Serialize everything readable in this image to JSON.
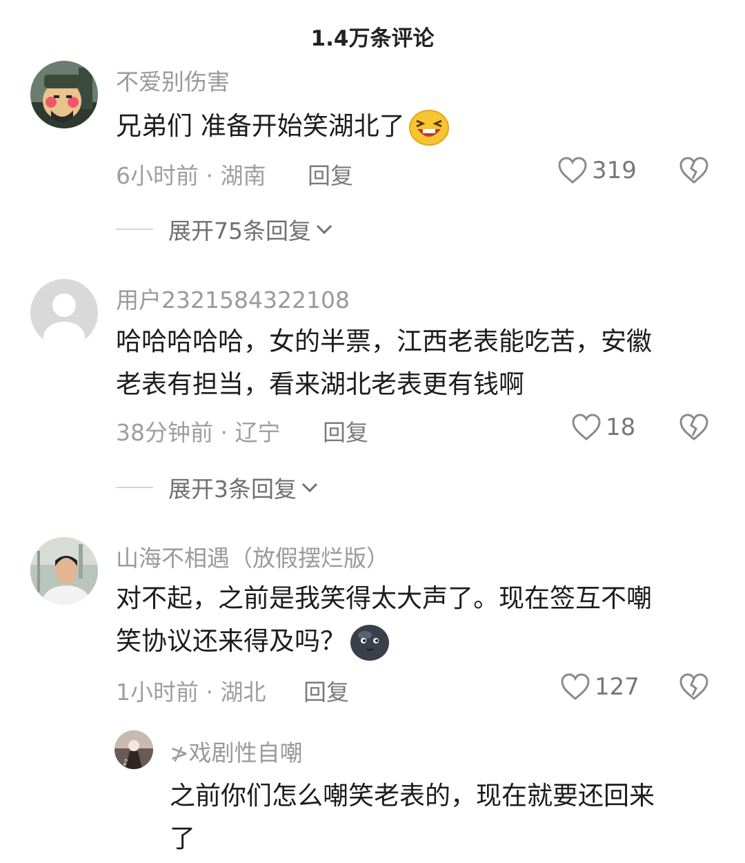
{
  "header": {
    "title": "1.4万条评论"
  },
  "comments": [
    {
      "username": "不爱别伤害",
      "text": "兄弟们 准备开始笑湖北了",
      "emoji": "laughing-emoji",
      "time": "6小时前",
      "location": "湖南",
      "reply_label": "回复",
      "likes": "319",
      "expand_label": "展开75条回复"
    },
    {
      "username": "用户2321584322108",
      "text_lines": [
        "哈哈哈哈哈，女的半票，江西老表能吃苦，安徽",
        "老表有担当，看来湖北老表更有钱啊"
      ],
      "time": "38分钟前",
      "location": "辽宁",
      "reply_label": "回复",
      "likes": "18",
      "expand_label": "展开3条回复"
    },
    {
      "username": "山海不相遇（放假摆烂版）",
      "text_lines": [
        "对不起，之前是我笑得太大声了。现在签互不嘲",
        "笑协议还来得及吗？"
      ],
      "emoji": "dark-moon-face-emoji",
      "time": "1小时前",
      "location": "湖北",
      "reply_label": "回复",
      "likes": "127"
    }
  ],
  "reply": {
    "username": "≯戏剧性自嘲",
    "text_lines": [
      "之前你们怎么嘲笑老表的，现在就要还回来",
      "了"
    ]
  },
  "separator": " · ",
  "icons": {
    "like": "heart-outline-icon",
    "dislike": "broken-heart-icon",
    "expand": "chevron-down-icon"
  }
}
